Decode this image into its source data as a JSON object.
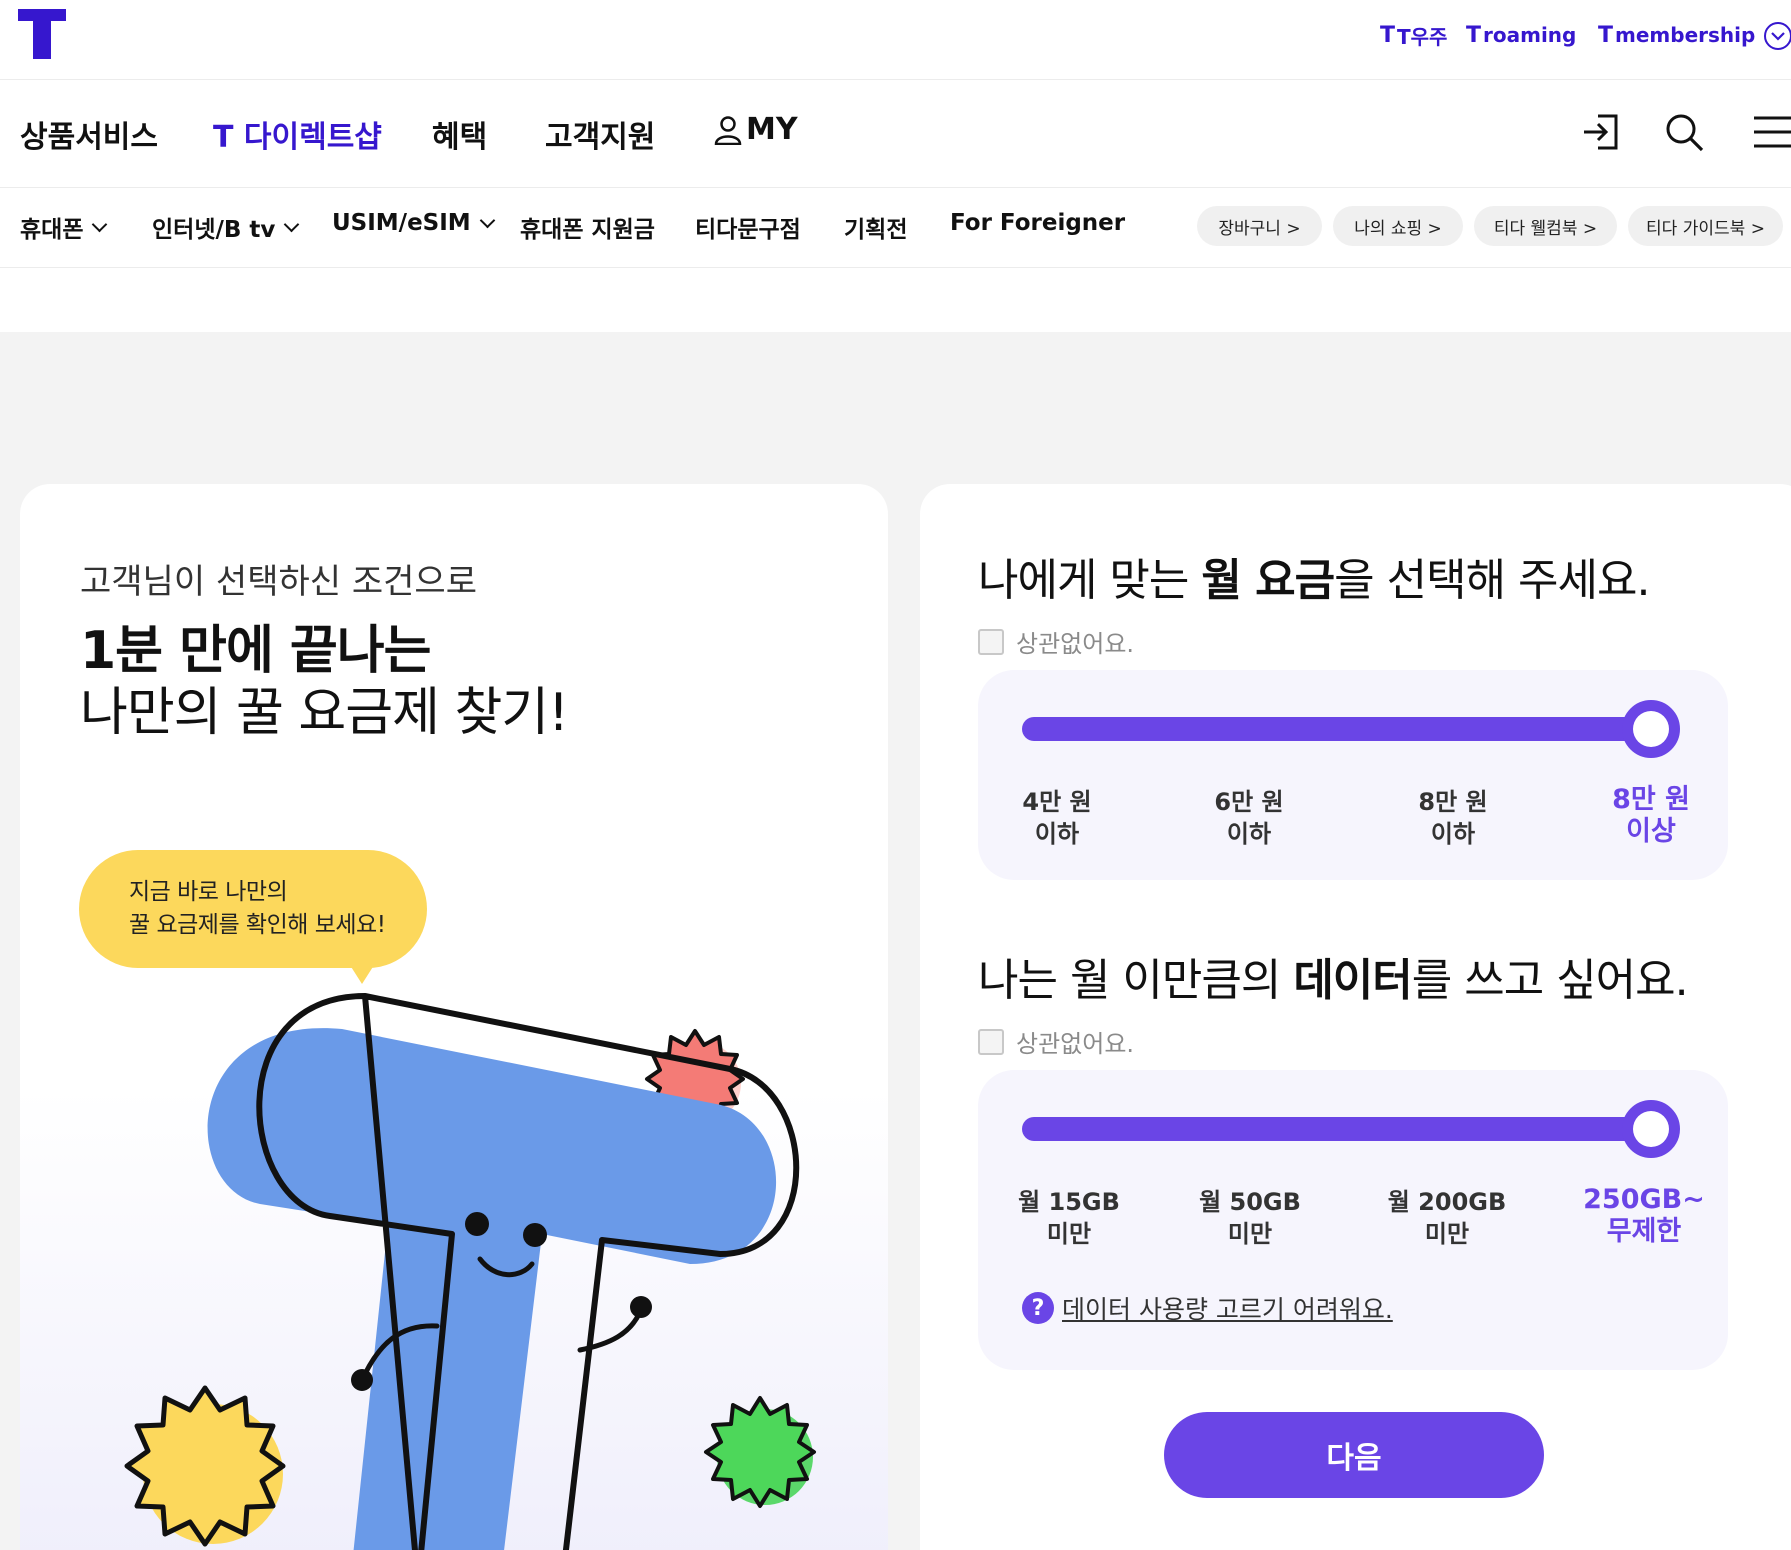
{
  "brand": {
    "accent": "#3617ce",
    "primary": "#6a45e6",
    "highlight": "#fcd85c"
  },
  "utility_links": [
    "T우주",
    "roaming",
    "membership"
  ],
  "main_nav": [
    "상품서비스",
    "T 다이렉트샵",
    "혜택",
    "고객지원",
    "MY"
  ],
  "sub_nav": [
    "휴대폰",
    "인터넷/B tv",
    "USIM/eSIM",
    "휴대폰 지원금",
    "티다문구점",
    "기획전",
    "For Foreigner"
  ],
  "pills": [
    "장바구니 >",
    "나의 쇼핑 >",
    "티다 웰컴북 >",
    "티다 가이드북 >"
  ],
  "intro": {
    "subtitle": "고객님이 선택하신 조건으로",
    "bold": "1분 만에 끝나는",
    "main": "나만의 꿀 요금제 찾기!",
    "bubble_line1": "지금 바로 나만의",
    "bubble_line2": "꿀 요금제를 확인해 보세요!"
  },
  "q1": {
    "title_pre": "나에게 맞는 ",
    "title_bold": "월 요금",
    "title_post": "을 선택해 주세요.",
    "nomatter": "상관없어요.",
    "ticks": [
      {
        "l1": "4만 원",
        "l2": "이하"
      },
      {
        "l1": "6만 원",
        "l2": "이하"
      },
      {
        "l1": "8만 원",
        "l2": "이하"
      },
      {
        "l1": "8만 원",
        "l2": "이상"
      }
    ],
    "selected_index": 3
  },
  "q2": {
    "title_pre": "나는 월 이만큼의 ",
    "title_bold": "데이터",
    "title_post": "를 쓰고 싶어요.",
    "nomatter": "상관없어요.",
    "ticks": [
      {
        "l1": "월 15GB",
        "l2": "미만"
      },
      {
        "l1": "월 50GB",
        "l2": "미만"
      },
      {
        "l1": "월 200GB",
        "l2": "미만"
      },
      {
        "l1": "250GB~",
        "l2": "무제한"
      }
    ],
    "selected_index": 3,
    "helper_icon": "?",
    "helper_link": "데이터 사용량 고르기 어려워요."
  },
  "next_button": "다음"
}
